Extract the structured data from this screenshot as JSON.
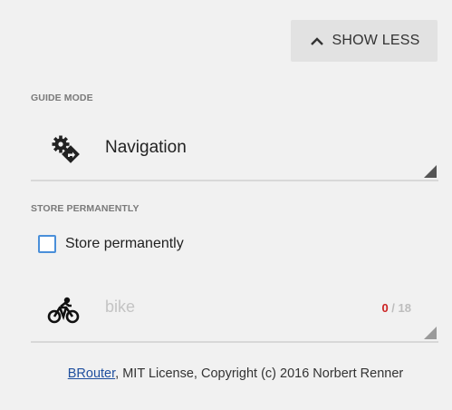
{
  "toolbar": {
    "show_less_label": "SHOW LESS",
    "show_less_icon": "chevron-up-icon"
  },
  "guide_mode": {
    "section_label": "GUIDE MODE",
    "selected_value": "Navigation",
    "icon": "navigation-settings-icon"
  },
  "store": {
    "section_label": "STORE PERMANENTLY",
    "checkbox_label": "Store permanently",
    "checked": false
  },
  "profile": {
    "icon": "bicycle-icon",
    "placeholder": "bike",
    "count_current": "0",
    "count_separator": " / ",
    "count_max": "18"
  },
  "footer": {
    "link_text": "BRouter",
    "text": ", MIT License, Copyright (c) 2016 Norbert Renner"
  },
  "colors": {
    "background": "#f1f1f1",
    "button_bg": "#e2e2e2",
    "checkbox_border": "#4a8fd9",
    "counter_current": "#cc2222",
    "link": "#1f4f9e"
  }
}
